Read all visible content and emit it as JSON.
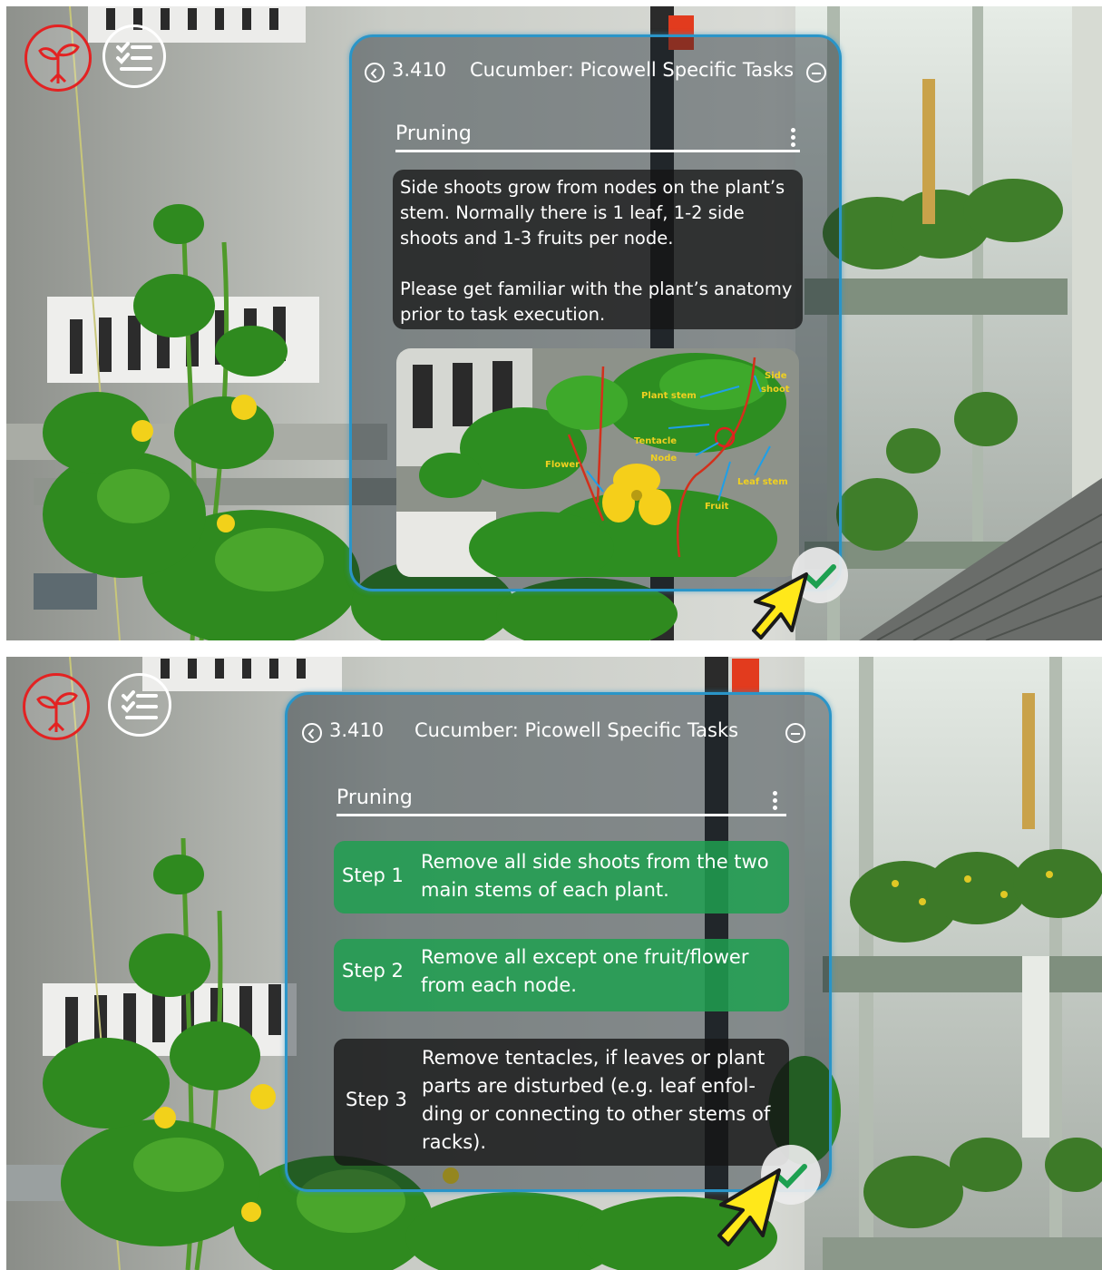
{
  "screens": [
    {
      "header": {
        "task_number": "3.410",
        "title": "Cucumber: Picowell Specific Tasks",
        "back_icon": "chevron-left-circle-icon",
        "collapse_icon": "minus-circle-icon"
      },
      "section": {
        "title": "Pruning",
        "menu_icon": "kebab-menu-icon"
      },
      "info": {
        "paragraph_1": "Side shoots grow from nodes on the plant’s stem. Normally there is 1 leaf, 1-2 side shoots and 1-3 fruits per node.",
        "paragraph_2": "Please get familiar with the plant’s anatomy prior to task execution."
      },
      "anatomy_labels": {
        "plant_stem": "Plant stem",
        "side_shoot_1": "Side",
        "side_shoot_2": "shoot",
        "tentacle": "Tentacle",
        "node": "Node",
        "flower": "Flower",
        "leaf_stem": "Leaf stem",
        "fruit": "Fruit"
      },
      "confirm_icon": "checkmark-icon"
    },
    {
      "header": {
        "task_number": "3.410",
        "title": "Cucumber: Picowell Specific Tasks",
        "back_icon": "chevron-left-circle-icon",
        "collapse_icon": "minus-circle-icon"
      },
      "section": {
        "title": "Pruning",
        "menu_icon": "kebab-menu-icon"
      },
      "steps": [
        {
          "label": "Step 1",
          "text": "Remove all side shoots from the two main stems of each plant.",
          "state": "done"
        },
        {
          "label": "Step 2",
          "text": "Remove all except one fruit/flower from each node.",
          "state": "done"
        },
        {
          "label": "Step 3",
          "text": "Remove tentacles, if leaves or plant parts are disturbed (e.g. leaf enfol-ding or connecting to other stems of racks).",
          "state": "pending"
        }
      ],
      "confirm_icon": "checkmark-icon"
    }
  ],
  "colors": {
    "panel_border": "#2a95c8",
    "step_done": "#1ea050",
    "step_pending": "#141414",
    "logo_red": "#e32222",
    "cursor_yellow": "#ffe81a",
    "annotation_blue": "#1e9fe8",
    "annotation_yellow": "#f0d020"
  }
}
